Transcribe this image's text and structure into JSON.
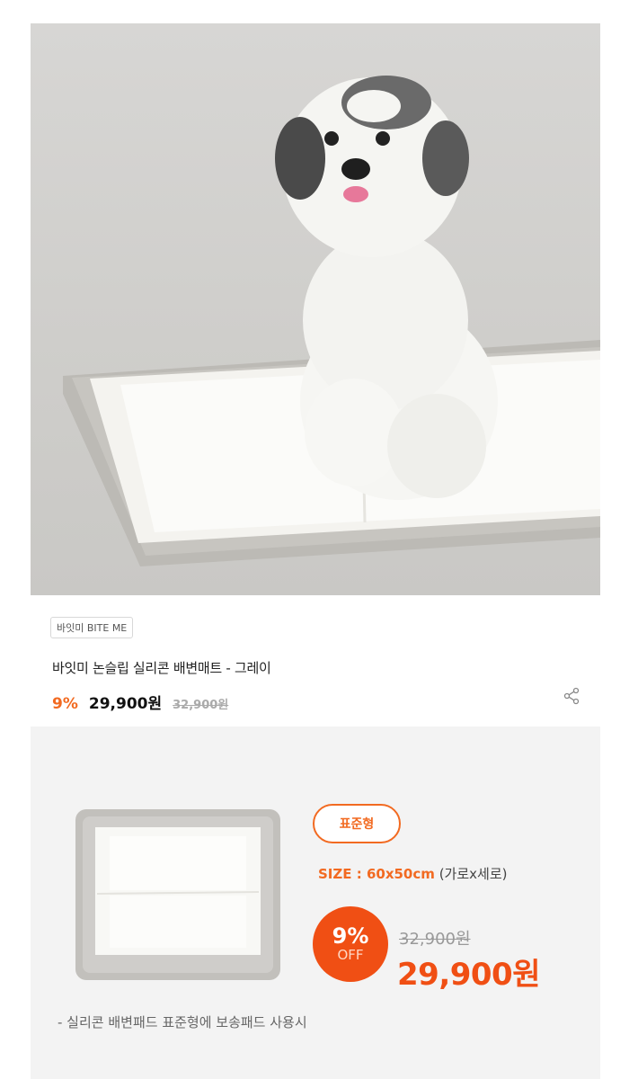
{
  "hero": {
    "image_label": "gray dog sitting on silicone pad mat",
    "carousel": {
      "count": 3,
      "active": 1
    }
  },
  "product": {
    "brand_badge": "바잇미 BITE ME",
    "title": "바잇미 논슬립 실리콘 배변매트 - 그레이",
    "discount": "9%",
    "price": "29,900원",
    "original_price": "32,900원"
  },
  "promo": {
    "type_pill": "표준형",
    "size_label": "SIZE : 60x50cm",
    "size_unit": "(가로x세로)",
    "discount_pct": "9%",
    "discount_word": "OFF",
    "original_price": "32,900원",
    "sale_price": "29,900원",
    "note": "- 실리콘 배변패드 표준형에 보송패드 사용시"
  },
  "colors": {
    "accent": "#f26a21",
    "accent_dark": "#f04f14",
    "mat_gray": "#bdbbb6"
  }
}
